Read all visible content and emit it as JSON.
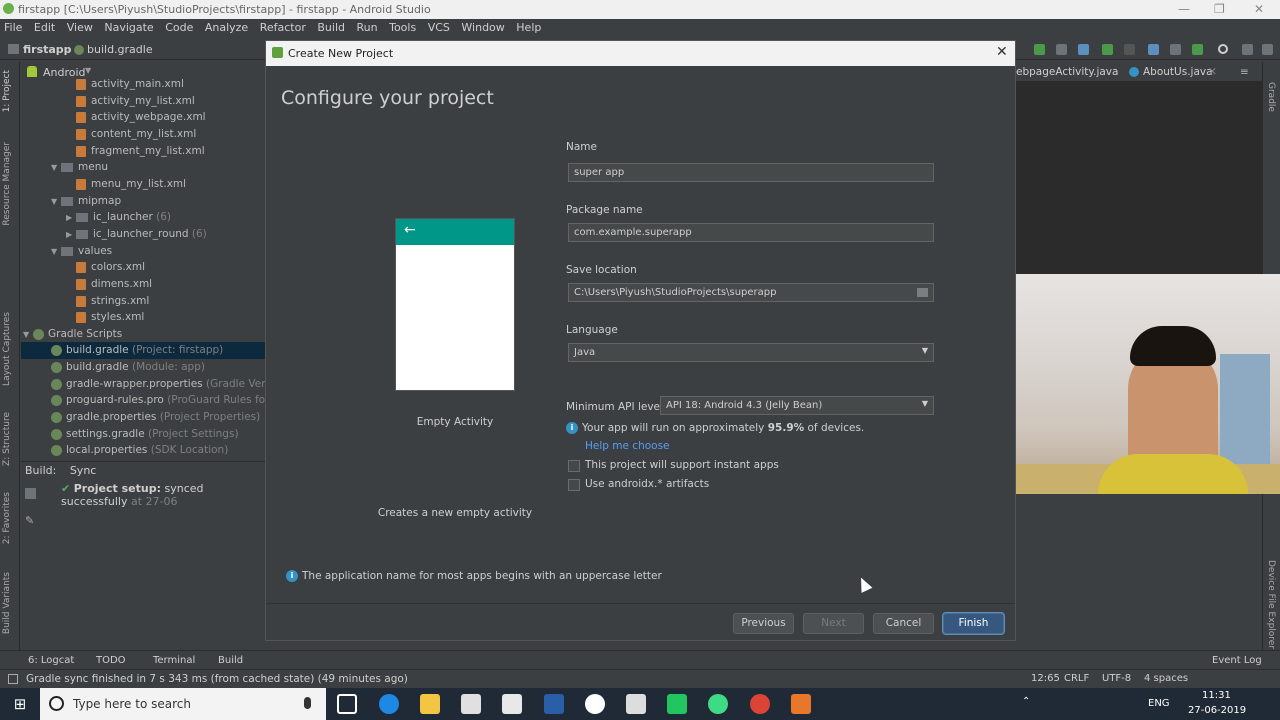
{
  "window": {
    "title": "firstapp [C:\\Users\\Piyush\\StudioProjects\\firstapp] - firstapp - Android Studio"
  },
  "menu": [
    "File",
    "Edit",
    "View",
    "Navigate",
    "Code",
    "Analyze",
    "Refactor",
    "Build",
    "Run",
    "Tools",
    "VCS",
    "Window",
    "Help"
  ],
  "breadcrumb": {
    "project": "firstapp",
    "file": "build.gradle"
  },
  "left_strip": {
    "project": "1: Project",
    "resource": "Resource Manager",
    "captures": "Layout Captures",
    "structure": "Z: Structure",
    "favorites": "2: Favorites",
    "variants": "Build Variants"
  },
  "right_strip": {
    "gradle": "Gradle",
    "explorer": "Device File Explorer"
  },
  "project_panel": {
    "view": "Android",
    "rows": [
      {
        "label": "activity_main.xml",
        "hint": ""
      },
      {
        "label": "activity_my_list.xml",
        "hint": ""
      },
      {
        "label": "activity_webpage.xml",
        "hint": ""
      },
      {
        "label": "content_my_list.xml",
        "hint": ""
      },
      {
        "label": "fragment_my_list.xml",
        "hint": ""
      },
      {
        "label": "menu",
        "hint": ""
      },
      {
        "label": "menu_my_list.xml",
        "hint": ""
      },
      {
        "label": "mipmap",
        "hint": ""
      },
      {
        "label": "ic_launcher",
        "hint": "(6)"
      },
      {
        "label": "ic_launcher_round",
        "hint": "(6)"
      },
      {
        "label": "values",
        "hint": ""
      },
      {
        "label": "colors.xml",
        "hint": ""
      },
      {
        "label": "dimens.xml",
        "hint": ""
      },
      {
        "label": "strings.xml",
        "hint": ""
      },
      {
        "label": "styles.xml",
        "hint": ""
      },
      {
        "label": "Gradle Scripts",
        "hint": ""
      },
      {
        "label": "build.gradle",
        "hint": "(Project: firstapp)"
      },
      {
        "label": "build.gradle",
        "hint": "(Module: app)"
      },
      {
        "label": "gradle-wrapper.properties",
        "hint": "(Gradle Version)"
      },
      {
        "label": "proguard-rules.pro",
        "hint": "(ProGuard Rules for app)"
      },
      {
        "label": "gradle.properties",
        "hint": "(Project Properties)"
      },
      {
        "label": "settings.gradle",
        "hint": "(Project Settings)"
      },
      {
        "label": "local.properties",
        "hint": "(SDK Location)"
      }
    ]
  },
  "build_panel": {
    "tab_build": "Build:",
    "tab_sync": "Sync",
    "message": "Project setup:",
    "message_detail": "synced successfully",
    "time": "at 27-06"
  },
  "editor_tabs": {
    "tab1": "ebpageActivity.java",
    "tab2": "AboutUs.java"
  },
  "bottom_tabs": {
    "logcat": "6: Logcat",
    "todo": "TODO",
    "terminal": "Terminal",
    "build": "Build",
    "event_log": "Event Log"
  },
  "status": {
    "message": "Gradle sync finished in 7 s 343 ms (from cached state) (49 minutes ago)",
    "position": "12:65",
    "crlf": "CRLF",
    "encoding": "UTF-8",
    "spaces": "4 spaces"
  },
  "dialog": {
    "title": "Create New Project",
    "heading": "Configure your project",
    "template_name": "Empty Activity",
    "template_desc": "Creates a new empty activity",
    "name_label": "Name",
    "name_value": "super app",
    "package_label": "Package name",
    "package_value": "com.example.superapp",
    "save_label": "Save location",
    "save_value": "C:\\Users\\Piyush\\StudioProjects\\superapp",
    "language_label": "Language",
    "language_value": "Java",
    "api_label": "Minimum API level",
    "api_value": "API 18: Android 4.3 (Jelly Bean)",
    "api_info_pre": "Your app will run on approximately",
    "api_info_pct": "95.9%",
    "api_info_post": "of devices.",
    "help_link": "Help me choose",
    "instant_label": "This project will support instant apps",
    "androidx_label": "Use androidx.* artifacts",
    "footer_info": "The application name for most apps begins with an uppercase letter",
    "btn_previous": "Previous",
    "btn_next": "Next",
    "btn_cancel": "Cancel",
    "btn_finish": "Finish"
  },
  "taskbar": {
    "search_placeholder": "Type here to search",
    "lang": "ENG",
    "time": "11:31",
    "date": "27-06-2019"
  },
  "colors": {
    "accent": "#009688",
    "selection": "#0d293e",
    "primary_button": "#365880"
  }
}
